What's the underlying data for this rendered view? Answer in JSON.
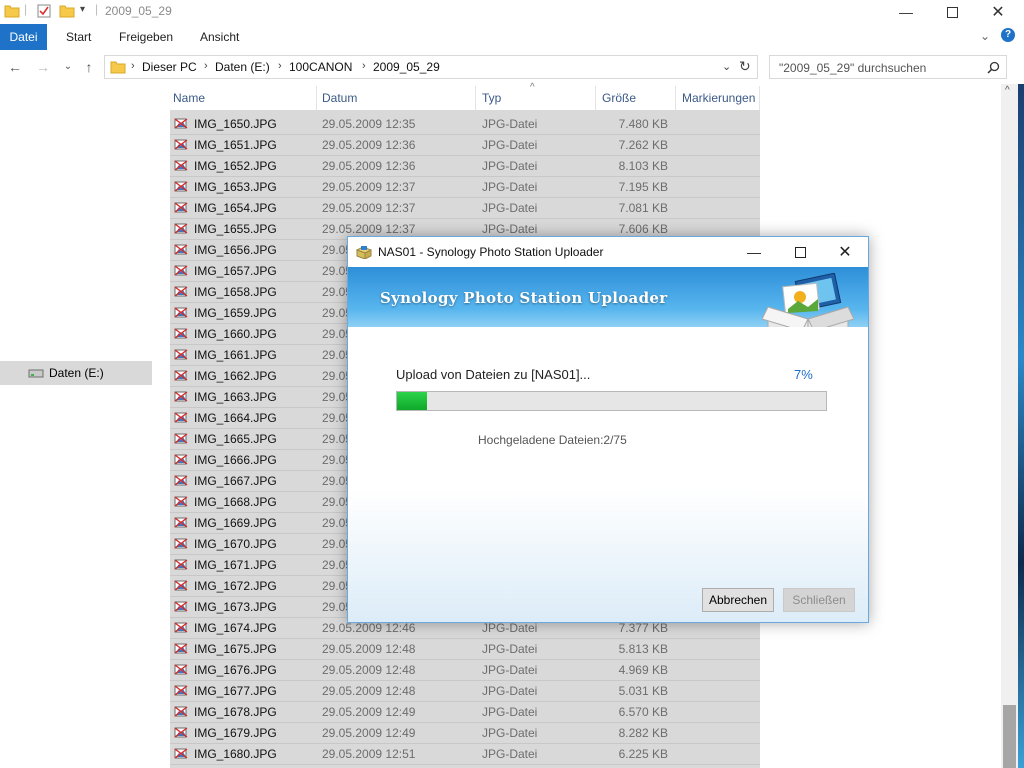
{
  "window": {
    "title": "2009_05_29"
  },
  "ribbon": {
    "tabs": [
      "Datei",
      "Start",
      "Freigeben",
      "Ansicht"
    ]
  },
  "address": {
    "crumbs": [
      "Dieser PC",
      "Daten (E:)",
      "100CANON",
      "2009_05_29"
    ]
  },
  "search": {
    "placeholder": "\"2009_05_29\" durchsuchen"
  },
  "nav": {
    "drive_label": "Daten (E:)"
  },
  "columns": [
    "Name",
    "Datum",
    "Typ",
    "Größe",
    "Markierungen"
  ],
  "files": [
    {
      "name": "IMG_1650.JPG",
      "date": "29.05.2009 12:35",
      "type": "JPG-Datei",
      "size": "7.480 KB"
    },
    {
      "name": "IMG_1651.JPG",
      "date": "29.05.2009 12:36",
      "type": "JPG-Datei",
      "size": "7.262 KB"
    },
    {
      "name": "IMG_1652.JPG",
      "date": "29.05.2009 12:36",
      "type": "JPG-Datei",
      "size": "8.103 KB"
    },
    {
      "name": "IMG_1653.JPG",
      "date": "29.05.2009 12:37",
      "type": "JPG-Datei",
      "size": "7.195 KB"
    },
    {
      "name": "IMG_1654.JPG",
      "date": "29.05.2009 12:37",
      "type": "JPG-Datei",
      "size": "7.081 KB"
    },
    {
      "name": "IMG_1655.JPG",
      "date": "29.05.2009 12:37",
      "type": "JPG-Datei",
      "size": "7.606 KB"
    },
    {
      "name": "IMG_1656.JPG",
      "date": "29.05",
      "type": "",
      "size": ""
    },
    {
      "name": "IMG_1657.JPG",
      "date": "29.05",
      "type": "",
      "size": ""
    },
    {
      "name": "IMG_1658.JPG",
      "date": "29.05",
      "type": "",
      "size": ""
    },
    {
      "name": "IMG_1659.JPG",
      "date": "29.05",
      "type": "",
      "size": ""
    },
    {
      "name": "IMG_1660.JPG",
      "date": "29.05",
      "type": "",
      "size": ""
    },
    {
      "name": "IMG_1661.JPG",
      "date": "29.05",
      "type": "",
      "size": ""
    },
    {
      "name": "IMG_1662.JPG",
      "date": "29.05",
      "type": "",
      "size": ""
    },
    {
      "name": "IMG_1663.JPG",
      "date": "29.05",
      "type": "",
      "size": ""
    },
    {
      "name": "IMG_1664.JPG",
      "date": "29.05",
      "type": "",
      "size": ""
    },
    {
      "name": "IMG_1665.JPG",
      "date": "29.05",
      "type": "",
      "size": ""
    },
    {
      "name": "IMG_1666.JPG",
      "date": "29.05",
      "type": "",
      "size": ""
    },
    {
      "name": "IMG_1667.JPG",
      "date": "29.05",
      "type": "",
      "size": ""
    },
    {
      "name": "IMG_1668.JPG",
      "date": "29.05",
      "type": "",
      "size": ""
    },
    {
      "name": "IMG_1669.JPG",
      "date": "29.05",
      "type": "",
      "size": ""
    },
    {
      "name": "IMG_1670.JPG",
      "date": "29.05",
      "type": "",
      "size": ""
    },
    {
      "name": "IMG_1671.JPG",
      "date": "29.05",
      "type": "",
      "size": ""
    },
    {
      "name": "IMG_1672.JPG",
      "date": "29.05",
      "type": "",
      "size": ""
    },
    {
      "name": "IMG_1673.JPG",
      "date": "29.05",
      "type": "",
      "size": ""
    },
    {
      "name": "IMG_1674.JPG",
      "date": "29.05.2009 12:46",
      "type": "JPG-Datei",
      "size": "7.377 KB"
    },
    {
      "name": "IMG_1675.JPG",
      "date": "29.05.2009 12:48",
      "type": "JPG-Datei",
      "size": "5.813 KB"
    },
    {
      "name": "IMG_1676.JPG",
      "date": "29.05.2009 12:48",
      "type": "JPG-Datei",
      "size": "4.969 KB"
    },
    {
      "name": "IMG_1677.JPG",
      "date": "29.05.2009 12:48",
      "type": "JPG-Datei",
      "size": "5.031 KB"
    },
    {
      "name": "IMG_1678.JPG",
      "date": "29.05.2009 12:49",
      "type": "JPG-Datei",
      "size": "6.570 KB"
    },
    {
      "name": "IMG_1679.JPG",
      "date": "29.05.2009 12:49",
      "type": "JPG-Datei",
      "size": "8.282 KB"
    },
    {
      "name": "IMG_1680.JPG",
      "date": "29.05.2009 12:51",
      "type": "JPG-Datei",
      "size": "6.225 KB"
    }
  ],
  "dialog": {
    "title": "NAS01 - Synology Photo Station Uploader",
    "banner": "Synology Photo Station Uploader",
    "status": "Upload von Dateien zu [NAS01]...",
    "percent_text": "7%",
    "progress_fraction": 0.07,
    "uploaded_text": "Hochgeladene Dateien:2/75",
    "abort_label": "Abbrechen",
    "close_label": "Schließen"
  },
  "colors": {
    "accent": "#1e73c8",
    "progress": "#16b534",
    "selection": "#d9d9d9"
  }
}
